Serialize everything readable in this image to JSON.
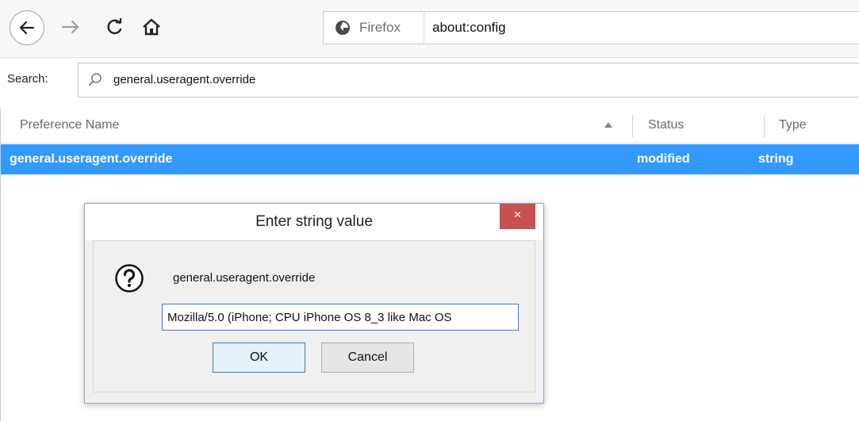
{
  "toolbar": {
    "identity_label": "Firefox",
    "url": "about:config"
  },
  "search": {
    "label": "Search:",
    "value": "general.useragent.override"
  },
  "table": {
    "columns": [
      "Preference Name",
      "Status",
      "Type"
    ],
    "rows": [
      {
        "name": "general.useragent.override",
        "status": "modified",
        "type": "string"
      }
    ]
  },
  "dialog": {
    "title": "Enter string value",
    "close_glyph": "×",
    "preference_name": "general.useragent.override",
    "value": "Mozilla/5.0 (iPhone; CPU iPhone OS 8_3 like Mac OS",
    "ok_label": "OK",
    "cancel_label": "Cancel"
  },
  "colors": {
    "selection": "#3399ff",
    "close_button": "#c75050"
  },
  "icons": [
    "back-arrow-icon",
    "forward-arrow-icon",
    "reload-icon",
    "home-icon",
    "firefox-icon",
    "search-icon",
    "sort-ascending-icon",
    "question-icon"
  ]
}
